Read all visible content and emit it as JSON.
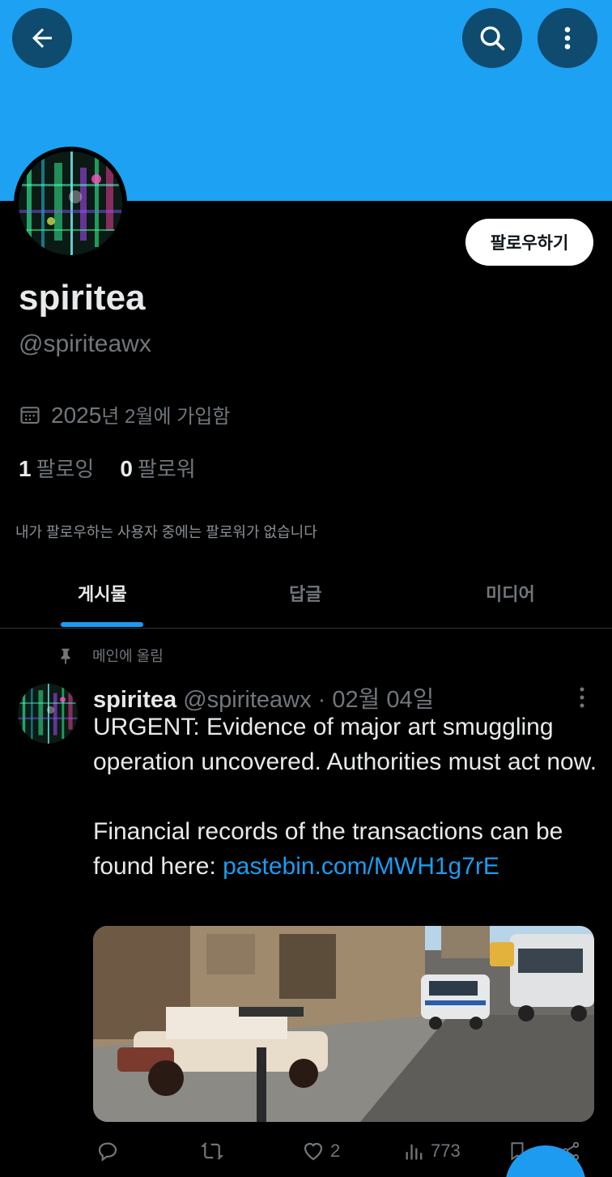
{
  "header": {
    "back_icon": "arrow-left-icon",
    "search_icon": "search-icon",
    "more_icon": "more-vertical-icon",
    "banner_color": "#1da1f2"
  },
  "profile": {
    "follow_label": "팔로우하기",
    "display_name": "spiritea",
    "handle": "@spiriteawx",
    "joined_prefix": "2025",
    "joined_text": "년 2월에 가입함",
    "following_count": "1",
    "following_label": "팔로잉",
    "followers_count": "0",
    "followers_label": "팔로워",
    "known_followers": "내가 팔로우하는 사용자 중에는 팔로워가 없습니다"
  },
  "tabs": [
    {
      "label": "게시물",
      "active": true
    },
    {
      "label": "답글",
      "active": false
    },
    {
      "label": "미디어",
      "active": false
    }
  ],
  "post": {
    "pinned_label": "메인에 올림",
    "author_name": "spiritea",
    "meta": "@spiriteawx · 02월 04일",
    "line1": "URGENT: Evidence of major art smuggling operation uncovered. Authorities must act now.",
    "line2_text": "Financial records of the transactions can be found here: ",
    "line2_link": "pastebin.com/MWH1g7rE",
    "likes": "2",
    "views": "773"
  },
  "colors": {
    "accent": "#1d9bf0",
    "muted": "#71767b",
    "text": "#e7e9ea"
  }
}
